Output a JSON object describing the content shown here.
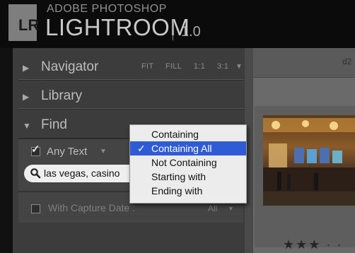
{
  "app": {
    "logo_text": "LR",
    "product_small": "ADOBE PHOTOSHOP",
    "product_big": "LIGHTROOM",
    "version": "1.0"
  },
  "panels": {
    "navigator": {
      "label": "Navigator",
      "state": "collapsed",
      "zoom": [
        "FIT",
        "FILL",
        "1:1",
        "3:1"
      ]
    },
    "library": {
      "label": "Library",
      "state": "collapsed"
    },
    "find": {
      "label": "Find",
      "state": "expanded",
      "text_filter_label": "Any Text",
      "text_filter_checked": true,
      "search_value": "las vegas, casino",
      "capture_date_label": "With Capture Date :",
      "capture_date_checked": false,
      "capture_date_value": "All"
    }
  },
  "dropdown": {
    "options": [
      "Containing",
      "Containing All",
      "Not Containing",
      "Starting with",
      "Ending with"
    ],
    "selected_index": 1,
    "check_glyph": "✓"
  },
  "grid": {
    "topbar_label": "d2",
    "rating_stars": "★★★ · ·"
  },
  "colors": {
    "panel_bg": "#3c3c3c",
    "selection_blue": "#2f5bd4",
    "menu_bg": "#ececec"
  }
}
